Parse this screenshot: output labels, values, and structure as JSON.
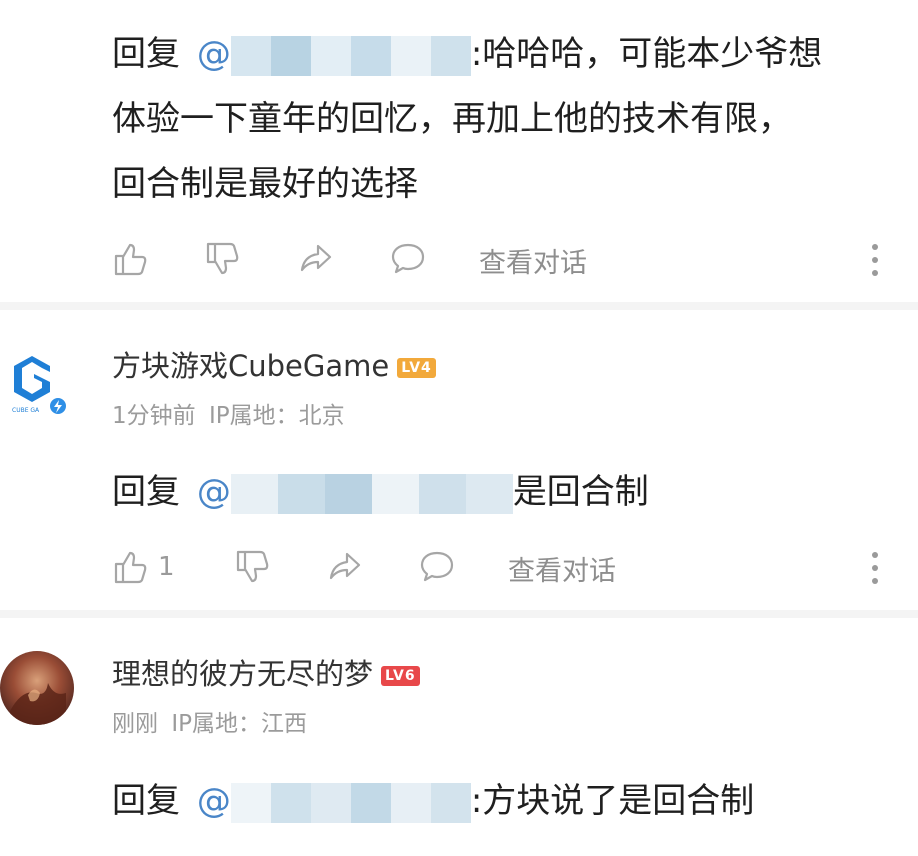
{
  "comments": [
    {
      "reply_prefix": "回复",
      "at": "@",
      "reply_line1_tail": ":哈哈哈，可能本少爷想",
      "reply_line2": "体验一下童年的回忆，再加上他的技术有限，",
      "reply_line3": "回合制是最好的选择",
      "like_count": "",
      "view_conversation": "查看对话"
    },
    {
      "username": "方块游戏CubeGame",
      "level": "LV4",
      "level_color": "#f2a93b",
      "time": "1分钟前",
      "ip_location": "IP属地：北京",
      "avatar_icon": "cube-game-logo-icon",
      "reply_prefix": "回复",
      "at": "@",
      "reply_tail": "是回合制",
      "like_count": "1",
      "view_conversation": "查看对话"
    },
    {
      "username": "理想的彼方无尽的梦",
      "level": "LV6",
      "level_color": "#e8484a",
      "time": "刚刚",
      "ip_location": "IP属地：江西",
      "avatar_icon": "user-avatar",
      "reply_prefix": "回复",
      "at": "@",
      "reply_tail": ":方块说了是回合制"
    }
  ],
  "icons": {
    "like": "thumbs-up-icon",
    "dislike": "thumbs-down-icon",
    "share": "share-icon",
    "comment": "comment-bubble-icon",
    "more": "more-vertical-icon"
  },
  "colors": {
    "text": "#1f1f1f",
    "muted": "#9b9b9b",
    "separator": "#f4f4f4",
    "mention": "#4a86c8"
  }
}
